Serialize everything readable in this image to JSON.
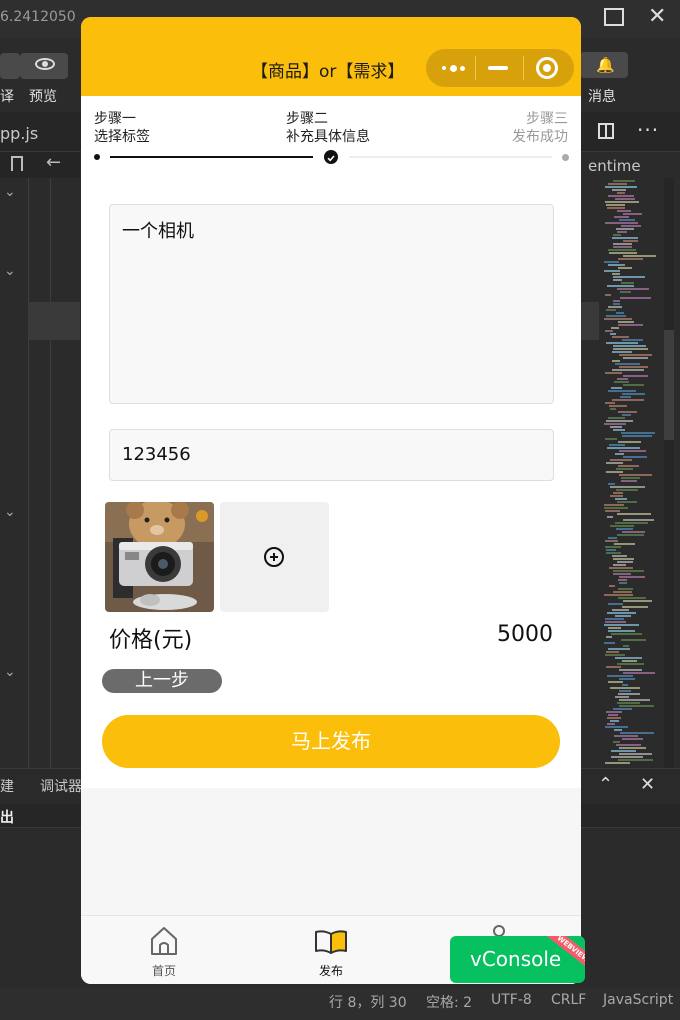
{
  "ide": {
    "version": "6.2412050",
    "toolbar_left": "译",
    "toolbar_preview": "预览",
    "toolbar_messages": "消息",
    "tab_file": "pp.js",
    "runtime": "entime",
    "bottom_tab_1": "建",
    "bottom_tab_2": "调试器",
    "bottom_sub": "出",
    "status": {
      "position": "行 8，列 30",
      "spaces": "空格: 2",
      "encoding": "UTF-8",
      "eol": "CRLF",
      "language": "JavaScript"
    },
    "colors": {
      "background": "#2b2b2b",
      "panel": "#262626"
    }
  },
  "app": {
    "title": "【商品】or【需求】",
    "colors": {
      "brand": "#fbbe0b",
      "secondary_button": "#6b6b6b"
    },
    "steps": [
      {
        "name": "步骤一",
        "desc": "选择标签"
      },
      {
        "name": "步骤二",
        "desc": "补充具体信息"
      },
      {
        "name": "步骤三",
        "desc": "发布成功"
      }
    ],
    "current_step": 2,
    "description_value": "一个相机",
    "contact_value": "123456",
    "price_label": "价格(元)",
    "price_value": "5000",
    "prev_button": "上一步",
    "publish_button": "马上发布",
    "tabs": [
      {
        "label": "首页",
        "icon": "home-icon"
      },
      {
        "label": "发布",
        "icon": "book-icon"
      },
      {
        "label": "",
        "icon": "user-icon"
      }
    ]
  },
  "vconsole": {
    "label": "vConsole",
    "ribbon": "WEBVIEW",
    "color": "#07c160"
  }
}
